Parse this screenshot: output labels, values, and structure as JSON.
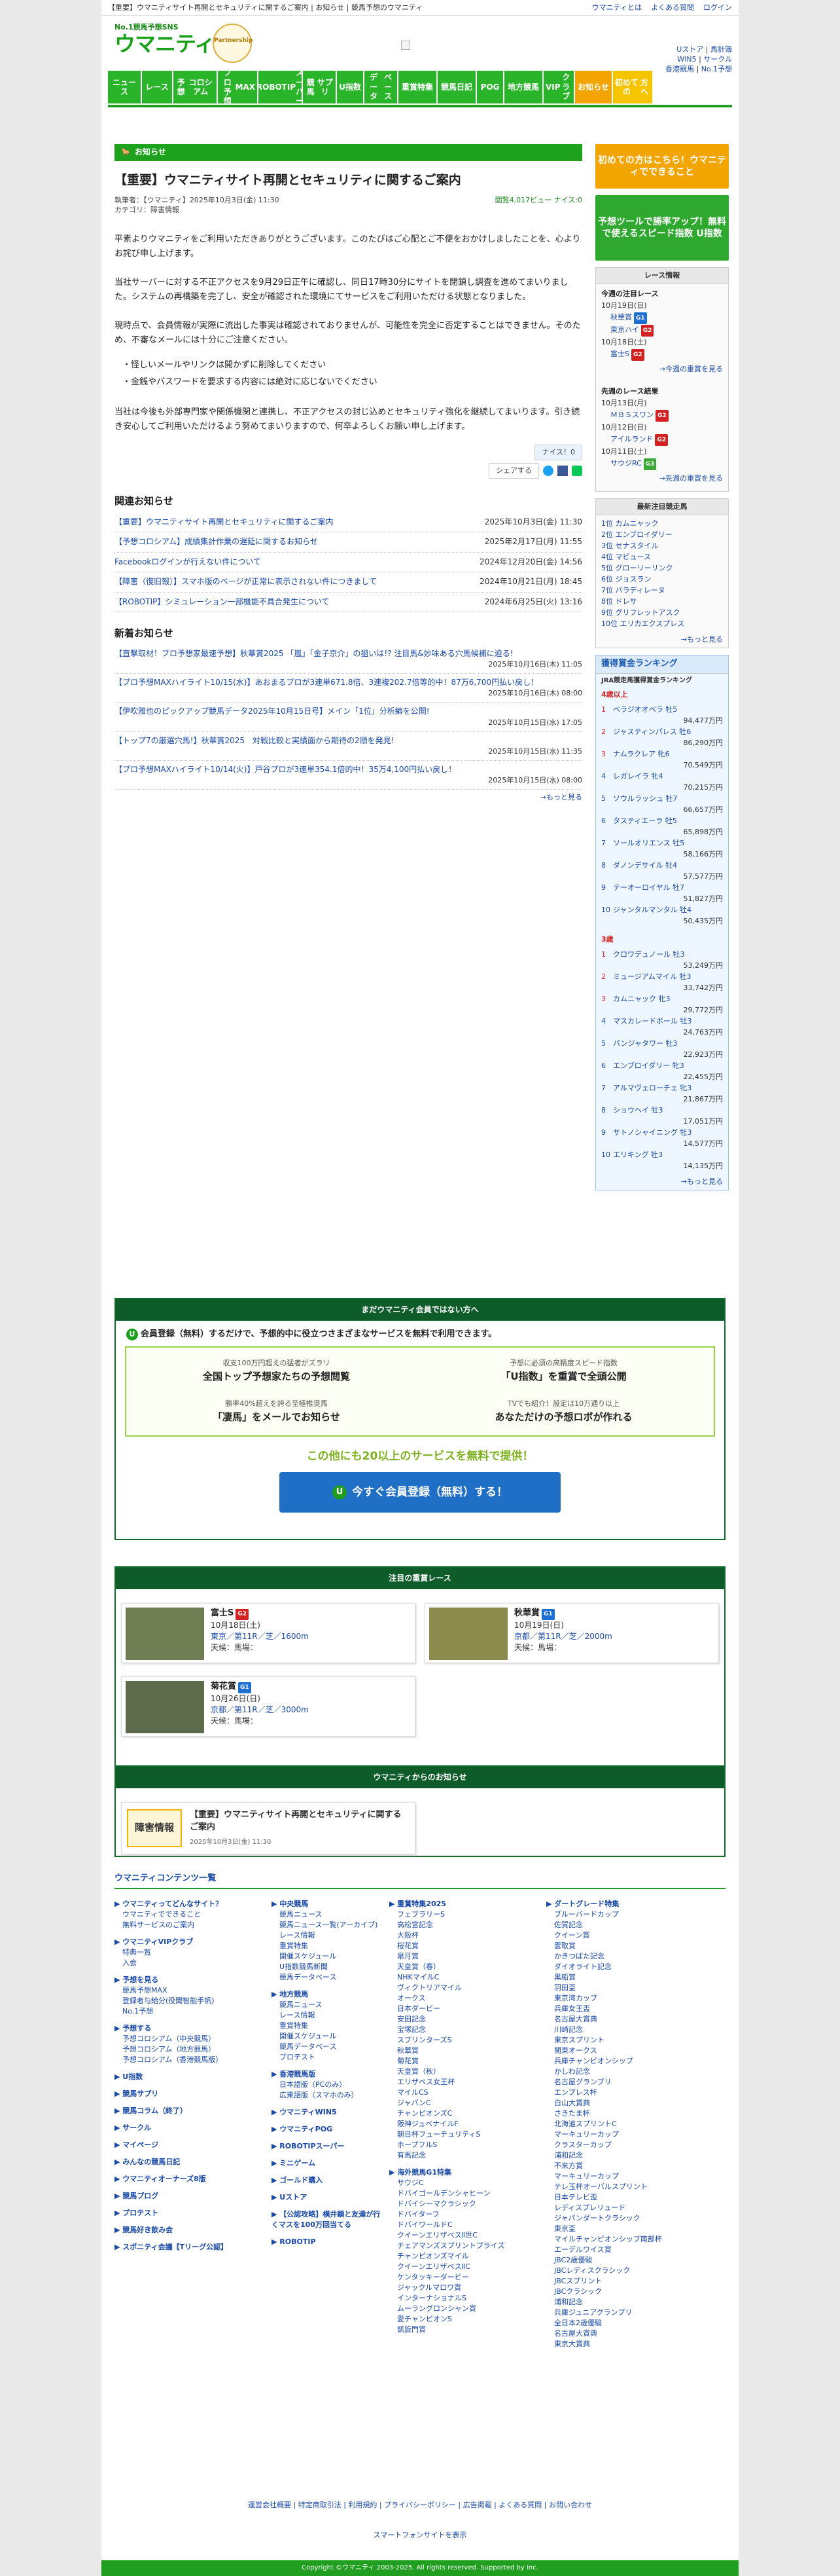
{
  "topbar": {
    "notice": "【重要】ウマニティサイト再開とセキュリティに関するご案内 | お知らせ | 競馬予想のウマニティ",
    "links": [
      "ウマニティとは",
      "よくある質問",
      "ログイン"
    ]
  },
  "header": {
    "logo_small": "No.1競馬予想SNS",
    "logo_big": "ウマニティ",
    "badge": "Partnership",
    "right": [
      "Uストア",
      "馬針簿",
      "WIN5",
      "サークル",
      "香港競馬",
      "No.1予想"
    ]
  },
  "nav": [
    [
      "ニュース"
    ],
    [
      "レース"
    ],
    [
      "予想",
      "コロシアム"
    ],
    [
      "プロ予想",
      "MAX"
    ],
    [
      "ROBOTIP",
      "スーパー"
    ],
    [
      "競馬",
      "サプリ"
    ],
    [
      "U指数"
    ],
    [
      "データ",
      "ベース"
    ],
    [
      "重賞特集"
    ],
    [
      "競馬日記"
    ],
    [
      "POG"
    ],
    [
      "地方競馬"
    ],
    [
      "VIP",
      "クラブ"
    ],
    [
      "お知らせ"
    ],
    [
      "初めての",
      "方へ"
    ]
  ],
  "section": "お知らせ",
  "article": {
    "title": "【重要】ウマニティサイト再開とセキュリティに関するご案内",
    "meta_left": "執筆者：【ウマニティ】2025年10月3日(金) 11:30",
    "category": "カテゴリ：障害情報",
    "meta_right": "閲覧4,017ビュー ナイス:0",
    "p1": "平素よりウマニティをご利用いただきありがとうございます。このたびはご心配とご不便をおかけしましたことを、心よりお詫び申し上げます。",
    "p2": "当社サーバーに対する不正アクセスを9月29日正午に確認し、同日17時30分にサイトを閉鎖し調査を進めてまいりました。システムの再構築を完了し、安全が確認された環境にてサービスをご利用いただける状態となりました。",
    "p3": "現時点で、会員情報が実際に流出した事実は確認されておりませんが、可能性を完全に否定することはできません。そのため、不審なメールには十分にご注意ください。",
    "b1": "・怪しいメールやリンクは開かずに削除してください",
    "b2": "・金銭やパスワードを要求する内容には絶対に応じないでください",
    "p4": "当社は今後も外部専門家や関係機関と連携し、不正アクセスの封じ込めとセキュリティ強化を継続してまいります。引き続き安心してご利用いただけるよう努めてまいりますので、何卒よろしくお願い申し上げます。",
    "nice": "ナイス！0",
    "share": "シェアする"
  },
  "related": {
    "title": "関連お知らせ",
    "items": [
      {
        "t": "【重要】ウマニティサイト再開とセキュリティに関するご案内",
        "d": "2025年10月3日(金) 11:30"
      },
      {
        "t": "【予想コロシアム】成績集計作業の遅延に関するお知らせ",
        "d": "2025年2月17日(月) 11:55"
      },
      {
        "t": "Facebookログインが行えない件について",
        "d": "2024年12月20日(金) 14:56"
      },
      {
        "t": "【障害（復旧報）】スマホ版のページが正常に表示されない件につきまして",
        "d": "2024年10月21日(月) 18:45"
      },
      {
        "t": "【ROBOTIP】シミュレーション一部機能不具合発生について",
        "d": "2024年6月25日(火) 13:16"
      }
    ]
  },
  "newest": {
    "title": "新着お知らせ",
    "items": [
      {
        "t": "【直撃取材！プロ予想家最速予想】秋華賞2025 「嵐」「金子京介」の狙いは!? 注目馬&妙味ある穴馬候補に迫る!",
        "d": "2025年10月16日(木) 11:05"
      },
      {
        "t": "【プロ予想MAXハイライト10/15(水)】あおまるプロが3連単671.8倍、3連複202.7倍等的中！87万6,700円払い戻し！",
        "d": "2025年10月16日(木) 08:00"
      },
      {
        "t": "【伊吹雅也のピックアップ競馬データ2025年10月15日号】メイン「1位」分析編を公開!",
        "d": "2025年10月15日(水) 17:05"
      },
      {
        "t": "【トップ7の厳選穴馬!】秋華賞2025　対戦比較と実績面から期待の2頭を発見!",
        "d": "2025年10月15日(水) 11:35"
      },
      {
        "t": "【プロ予想MAXハイライト10/14(火)】戸谷プロが3連単354.1倍的中！35万4,100円払い戻し！",
        "d": "2025年10月15日(水) 08:00"
      }
    ],
    "more": "→もっと見る"
  },
  "side": {
    "banner1": "初めての方はこちら！ウマニティでできること",
    "banner2": "予想ツールで勝率アップ！無料で使えるスピード指数 U指数",
    "race_info": {
      "title": "レース情報",
      "g1": "今週の注目レース",
      "g1_items": [
        [
          "10月19日(日)",
          ""
        ],
        [
          "秋華賞",
          "G1"
        ],
        [
          "東京ハイ",
          "G2"
        ],
        [
          "10月18日(土)",
          ""
        ],
        [
          "富士S",
          "G2"
        ]
      ],
      "more1": "→今週の重賞を見る",
      "g2": "先週のレース結果",
      "g2_items": [
        [
          "10月13日(月)",
          ""
        ],
        [
          "ＭＢＳスワン",
          "G2"
        ],
        [
          "10月12日(日)",
          ""
        ],
        [
          "アイルランド",
          "G2"
        ],
        [
          "10月11日(土)",
          ""
        ],
        [
          "サウジRC",
          "G3"
        ]
      ],
      "more2": "→先週の重賞を見る"
    },
    "horses": {
      "title": "最新注目競走馬",
      "items": [
        "1位 カムニャック",
        "2位 エンブロイダリー",
        "3位 セナスタイル",
        "4位 マピュース",
        "5位 グローリーリンク",
        "6位 ジョスラン",
        "7位 パラディレーヌ",
        "8位 ドレサ",
        "9位 グリフレットアスク",
        "10位 エリカエクスプレス"
      ],
      "more": "→もっと見る"
    },
    "rank": {
      "title": "獲得賞金ランキング",
      "sub": "JRA競走馬獲得賞金ランキング",
      "age4": "4歳以上",
      "list4": [
        [
          "ベラジオオペラ 牡5",
          "94,477万円"
        ],
        [
          "ジャスティンパレス 牡6",
          "86,290万円"
        ],
        [
          "ナムラクレア 牝6",
          "70,549万円"
        ],
        [
          "レガレイラ 牝4",
          "70,215万円"
        ],
        [
          "ソウルラッシュ 牡7",
          "66,657万円"
        ],
        [
          "タスティエーラ 牡5",
          "65,898万円"
        ],
        [
          "ソールオリエンス 牡5",
          "58,166万円"
        ],
        [
          "ダノンデサイル 牡4",
          "57,577万円"
        ],
        [
          "テーオーロイヤル 牡7",
          "51,827万円"
        ],
        [
          "ジャンタルマンタル 牡4",
          "50,435万円"
        ]
      ],
      "age3": "3歳",
      "list3": [
        [
          "クロワデュノール 牡3",
          "53,249万円"
        ],
        [
          "ミュージアムマイル 牡3",
          "33,742万円"
        ],
        [
          "カムニャック 牝3",
          "29,772万円"
        ],
        [
          "マスカレードボール 牡3",
          "24,763万円"
        ],
        [
          "パンジャタワー 牡3",
          "22,923万円"
        ],
        [
          "エンブロイダリー 牝3",
          "22,455万円"
        ],
        [
          "アルマヴェローチェ 牝3",
          "21,867万円"
        ],
        [
          "ショウヘイ 牡3",
          "17,051万円"
        ],
        [
          "サトノシャイニング 牡3",
          "14,577万円"
        ],
        [
          "エリキング 牡3",
          "14,135万円"
        ]
      ],
      "more": "→もっと見る"
    }
  },
  "campaign": {
    "head": "まだウマニティ会員ではない方へ",
    "lead": "会員登録（無料）するだけで、予想的中に役立つさまざまなサービスを無料で利用できます。",
    "cells": [
      [
        "収支100万円超えの猛者がズラリ",
        "全国トップ予想家たちの予想閲覧"
      ],
      [
        "予想に必須の高精度スピード指数",
        "「U指数」を重賞で全頭公開"
      ],
      [
        "勝率40%超えを誇る至極推奨馬",
        "「凄馬」をメールでお知らせ"
      ],
      [
        "TVでも紹介！設定は10万通り以上",
        "あなただけの予想ロボが作れる"
      ]
    ],
    "others": "この他にも20以上のサービスを無料で提供！",
    "button": "今すぐ会員登録（無料）する！"
  },
  "races": {
    "head": "注目の重賞レース",
    "items": [
      {
        "name": "富士S",
        "grade": "G2",
        "date": "10月18日(土)",
        "info": "東京／第11R／芝／1600m",
        "horse": "天候：馬場："
      },
      {
        "name": "秋華賞",
        "grade": "G1",
        "date": "10月19日(日)",
        "info": "京都／第11R／芝／2000m",
        "horse": "天候：馬場："
      },
      {
        "name": "菊花賞",
        "grade": "G1",
        "date": "10月26日(日)",
        "info": "京都／第11R／芝／3000m",
        "horse": "天候：馬場："
      }
    ]
  },
  "notice": {
    "head": "ウマニティからのお知らせ",
    "tag": "障害情報",
    "title": "【重要】ウマニティサイト再開とセキュリティに関するご案内",
    "date": "2025年10月3日(金) 11:30"
  },
  "footer": {
    "title": "ウマニティコンテンツ一覧",
    "col1": [
      [
        "ウマニティってどんなサイト？",
        [
          "ウマニティでできること",
          "無料サービスのご案内"
        ]
      ],
      [
        "ウマニティVIPクラブ",
        [
          "特典一覧",
          "入会"
        ]
      ],
      [
        "予想を見る",
        [
          "競馬予想MAX",
          "登録者与給分(役聞智能手帆)",
          "No.1予想"
        ]
      ],
      [
        "予想する",
        [
          "予想コロシアム（中央競馬）",
          "予想コロシアム（地方競馬）",
          "予想コロシアム（香港競馬版）"
        ]
      ],
      [
        "U指数",
        []
      ],
      [
        "競馬サプリ",
        []
      ],
      [
        "競馬コラム（終了）",
        []
      ],
      [
        "サークル",
        []
      ],
      [
        "マイページ",
        []
      ],
      [
        "みんなの競馬日記",
        []
      ],
      [
        "ウマニティオーナーズ8版",
        []
      ],
      [
        "競馬プログ",
        []
      ],
      [
        "プロテスト",
        []
      ],
      [
        "競馬好き飲み会",
        []
      ],
      [
        "スポニティ会議【Tリーグ公認】",
        []
      ]
    ],
    "col2": [
      [
        "中央競馬",
        [
          "競馬ニュース",
          "競馬ニュース一覧(アーカイブ)",
          "レース情報",
          "重賞特集",
          "開催スケジュール",
          "U指数競馬新聞",
          "競馬データベース"
        ]
      ],
      [
        "地方競馬",
        [
          "競馬ニュース",
          "レース情報",
          "重賞特集",
          "開催スケジュール",
          "競馬データベース",
          "プロテスト"
        ]
      ],
      [
        "香港競馬版",
        [
          "日本語版（PCのみ）",
          "広東語版（スマホのみ）"
        ]
      ],
      [
        "ウマニティWIN5",
        []
      ],
      [
        "ウマニティPOG",
        []
      ],
      [
        "ROBOTIPスーパー",
        []
      ],
      [
        "ミニゲーム",
        []
      ],
      [
        "ゴールド購入",
        []
      ],
      [
        "Uストア",
        []
      ],
      [
        "【公認攻略】横井顕と友達が行くマスを100万回当てる",
        []
      ],
      [
        "ROBOTIP",
        []
      ]
    ],
    "col3": [
      [
        "重賞特集2025",
        [
          "フェブラリーS",
          "高松宮記念",
          "大阪杯",
          "桜花賞",
          "皐月賞",
          "天皇賞（春）",
          "NHKマイルC",
          "ヴィクトリアマイル",
          "オークス",
          "日本ダービー",
          "安田記念",
          "宝塚記念",
          "スプリンターズS",
          "秋華賞",
          "菊花賞",
          "天皇賞（秋）",
          "エリザベス女王杯",
          "マイルCS",
          "ジャパンC",
          "チャンピオンズC",
          "阪神ジュベナイルF",
          "朝日杯フューチュリティS",
          "ホープフルS",
          "有馬記念"
        ]
      ],
      [
        "海外競馬G1特集",
        [
          "サウジC",
          "ドバイゴールデンシャヒーン",
          "ドバイシーマクラシック",
          "ドバイターフ",
          "ドバイワールドC",
          "クイーンエリザベスⅡ世C",
          "チェアマンズスプリントプライズ",
          "チャンピオンズマイル",
          "クイーンエリザベスⅡC",
          "ケンタッキーダービー",
          "ジャックルマロワ賞",
          "インターナショナルS",
          "ムーラングロンシャン賞",
          "愛チャンピオンS",
          "凱旋門賞"
        ]
      ]
    ],
    "col4": [
      [
        "ダートグレード特集",
        [
          "ブルーバードカップ",
          "佐賀記念",
          "クイーン賞",
          "雲取賞",
          "かきつばた記念",
          "ダイオライト記念",
          "黒船賞",
          "羽田盃",
          "東京湾カップ",
          "兵庫女王盃",
          "名古屋大賞典",
          "川崎記念",
          "東京スプリント",
          "関東オークス",
          "兵庫チャンピオンシップ",
          "かしわ記念",
          "名古屋グランプリ",
          "エンプレス杯",
          "白山大賞典",
          "さきたま杯",
          "北海道スプリントC",
          "マーキュリーカップ",
          "クラスターカップ",
          "浦和記念",
          "不来方賞",
          "マーキュリーカップ",
          "テレ玉杯オーバルスプリント",
          "日本テレビ盃",
          "レディスプレリュード",
          "ジャパンダートクラシック",
          "東京盃",
          "マイルチャンピオンシップ南部杯",
          "エーデルワイス賞",
          "JBC2歳優駿",
          "JBCレディスクラシック",
          "JBCスプリント",
          "JBCクラシック",
          "浦和記念",
          "兵庫ジュニアグランプリ",
          "全日本2歳優駿",
          "名古屋大賞典",
          "東京大賞典"
        ]
      ]
    ]
  },
  "bottom_links": "運営会社概要 | 特定商取引法 | 利用規約 | プライバシーポリシー | 広告掲載 | よくある質問 | お問い合わせ",
  "pc_link": "スマートフォンサイトを表示",
  "copyright": "Copyright ©ウマニティ 2003-2025. All rights reserved. Supported by Inc.",
  "colors": {
    "green": "#1ea21e",
    "dark_green": "#0e5c2a",
    "blue": "#1f6fc6"
  }
}
